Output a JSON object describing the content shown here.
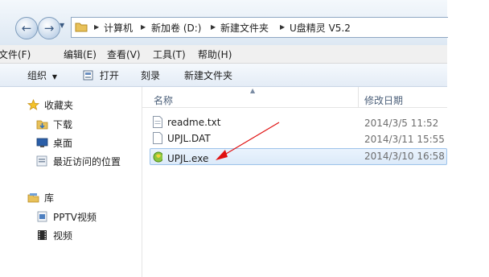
{
  "breadcrumb": {
    "items": [
      "计算机",
      "新加卷 (D:)",
      "新建文件夹",
      "U盘精灵 V5.2"
    ]
  },
  "menu": {
    "items": [
      "文件(F)",
      "编辑(E)",
      "查看(V)",
      "工具(T)",
      "帮助(H)"
    ]
  },
  "toolbar": {
    "organize": "组织",
    "open": "打开",
    "burn": "刻录",
    "new_folder": "新建文件夹"
  },
  "nav": {
    "favorites": "收藏夹",
    "downloads": "下载",
    "desktop": "桌面",
    "recent": "最近访问的位置",
    "libraries": "库",
    "pptv": "PPTV视频",
    "videos": "视频"
  },
  "columns": {
    "name": "名称",
    "date": "修改日期"
  },
  "files": [
    {
      "name": "readme.txt",
      "date": "2014/3/5 11:52"
    },
    {
      "name": "UPJL.DAT",
      "date": "2014/3/11 15:55"
    },
    {
      "name": "UPJL.exe",
      "date": "2014/3/10 16:58"
    }
  ],
  "colors": {
    "selection": "#dceaf9",
    "arrow": "#e01010"
  }
}
